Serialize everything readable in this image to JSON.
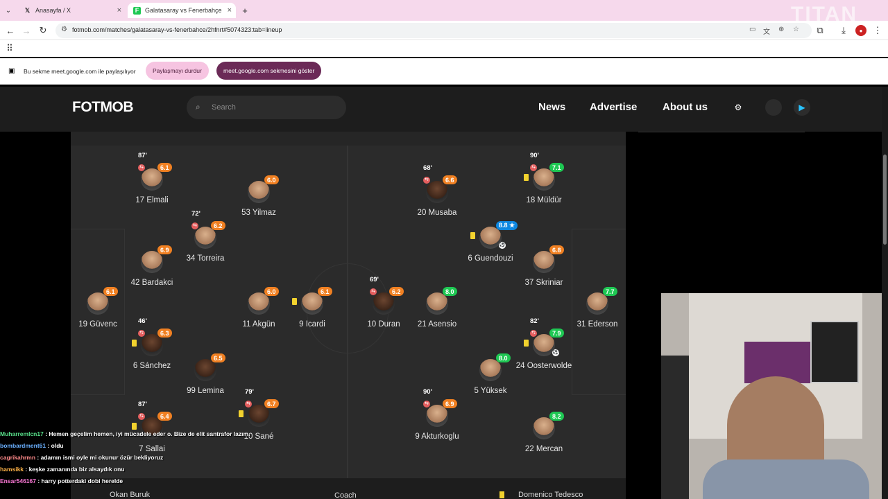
{
  "browser": {
    "tabs": [
      {
        "label": "Anasayfa / X",
        "favicon": "x-logo"
      },
      {
        "label": "Galatasaray vs Fenerbahçe",
        "favicon": "fotmob-logo"
      }
    ],
    "url": "fotmob.com/matches/galatasaray-vs-fenerbahce/2hfnrt#5074323:tab=lineup"
  },
  "share_bar": {
    "message": "Bu sekme meet.google.com ile paylaşılıyor",
    "stop_label": "Paylaşmayı durdur",
    "show_label": "meet.google.com sekmesini göster"
  },
  "site": {
    "logo": "FOTMOB",
    "search_placeholder": "Search",
    "nav": [
      "News",
      "Advertise",
      "About us"
    ],
    "icons": [
      "gear-icon",
      "apple-icon",
      "play-store-icon"
    ]
  },
  "lineup": {
    "home": [
      {
        "name": "17 Elmali",
        "rating": "6.1",
        "rating_color": "orange",
        "sub_time": "87'"
      },
      {
        "name": "53 Yilmaz",
        "rating": "6.0",
        "rating_color": "orange"
      },
      {
        "name": "34 Torreira",
        "rating": "6.2",
        "rating_color": "orange",
        "sub_time": "72'"
      },
      {
        "name": "42 Bardakci",
        "rating": "6.9",
        "rating_color": "orange"
      },
      {
        "name": "19 Güvenc",
        "rating": "6.1",
        "rating_color": "orange"
      },
      {
        "name": "11 Akgün",
        "rating": "6.0",
        "rating_color": "orange"
      },
      {
        "name": "9 Icardi",
        "rating": "6.1",
        "rating_color": "orange",
        "yellow_card": true
      },
      {
        "name": "6 Sánchez",
        "rating": "6.3",
        "rating_color": "orange",
        "sub_time": "46'",
        "yellow_card": true
      },
      {
        "name": "99 Lemina",
        "rating": "6.5",
        "rating_color": "orange"
      },
      {
        "name": "7 Sallai",
        "rating": "6.4",
        "rating_color": "orange",
        "sub_time": "87'",
        "yellow_card": true
      },
      {
        "name": "10 Sané",
        "rating": "6.7",
        "rating_color": "orange",
        "sub_time": "79'",
        "yellow_card": true
      }
    ],
    "away": [
      {
        "name": "20 Musaba",
        "rating": "6.6",
        "rating_color": "orange",
        "sub_time": "68'"
      },
      {
        "name": "18 Müldür",
        "rating": "7.1",
        "rating_color": "green",
        "sub_time": "90'",
        "yellow_card": true
      },
      {
        "name": "6 Guendouzi",
        "rating": "8.8",
        "rating_color": "blue",
        "yellow_card": true,
        "goal": true
      },
      {
        "name": "37 Skriniar",
        "rating": "6.8",
        "rating_color": "orange"
      },
      {
        "name": "10 Duran",
        "rating": "6.2",
        "rating_color": "orange",
        "sub_time": "69'"
      },
      {
        "name": "21 Asensio",
        "rating": "8.0",
        "rating_color": "green"
      },
      {
        "name": "31 Ederson",
        "rating": "7.7",
        "rating_color": "green"
      },
      {
        "name": "24 Oosterwolde",
        "rating": "7.9",
        "rating_color": "green",
        "sub_time": "82'",
        "yellow_card": true,
        "goal": true
      },
      {
        "name": "5 Yüksek",
        "rating": "8.0",
        "rating_color": "green"
      },
      {
        "name": "9 Akturkoglu",
        "rating": "6.9",
        "rating_color": "orange",
        "sub_time": "90'"
      },
      {
        "name": "22 Mercan",
        "rating": "8.2",
        "rating_color": "green"
      }
    ],
    "footer": {
      "coach_label": "Coach",
      "home_coach": "Okan Buruk",
      "away_coach": "Domenico Tedesco"
    }
  },
  "chat": [
    {
      "user": "Muharremlcn17",
      "text": ": Hemen geçelim hemen, iyi mücadele eder o. Bize de elit santrafor lazım.",
      "color": "#58e08a"
    },
    {
      "user": "bombardment61",
      "text": ": oldu",
      "color": "#6ab0ff"
    },
    {
      "user": "cagrikahrmn",
      "text": ": adamın ismi oyle mi okunur özür bekliyoruz",
      "color": "#ff8a8a"
    },
    {
      "user": "hamsikk",
      "text": ": keşke zamanında biz alsaydık onu",
      "color": "#ffb347"
    },
    {
      "user": "Ensar546167",
      "text": ": harry potterdaki dobi herelde",
      "color": "#ff7ad9"
    }
  ],
  "colors": {
    "orange": "#f08022",
    "green": "#1ec853",
    "blue": "#0e87e0"
  }
}
